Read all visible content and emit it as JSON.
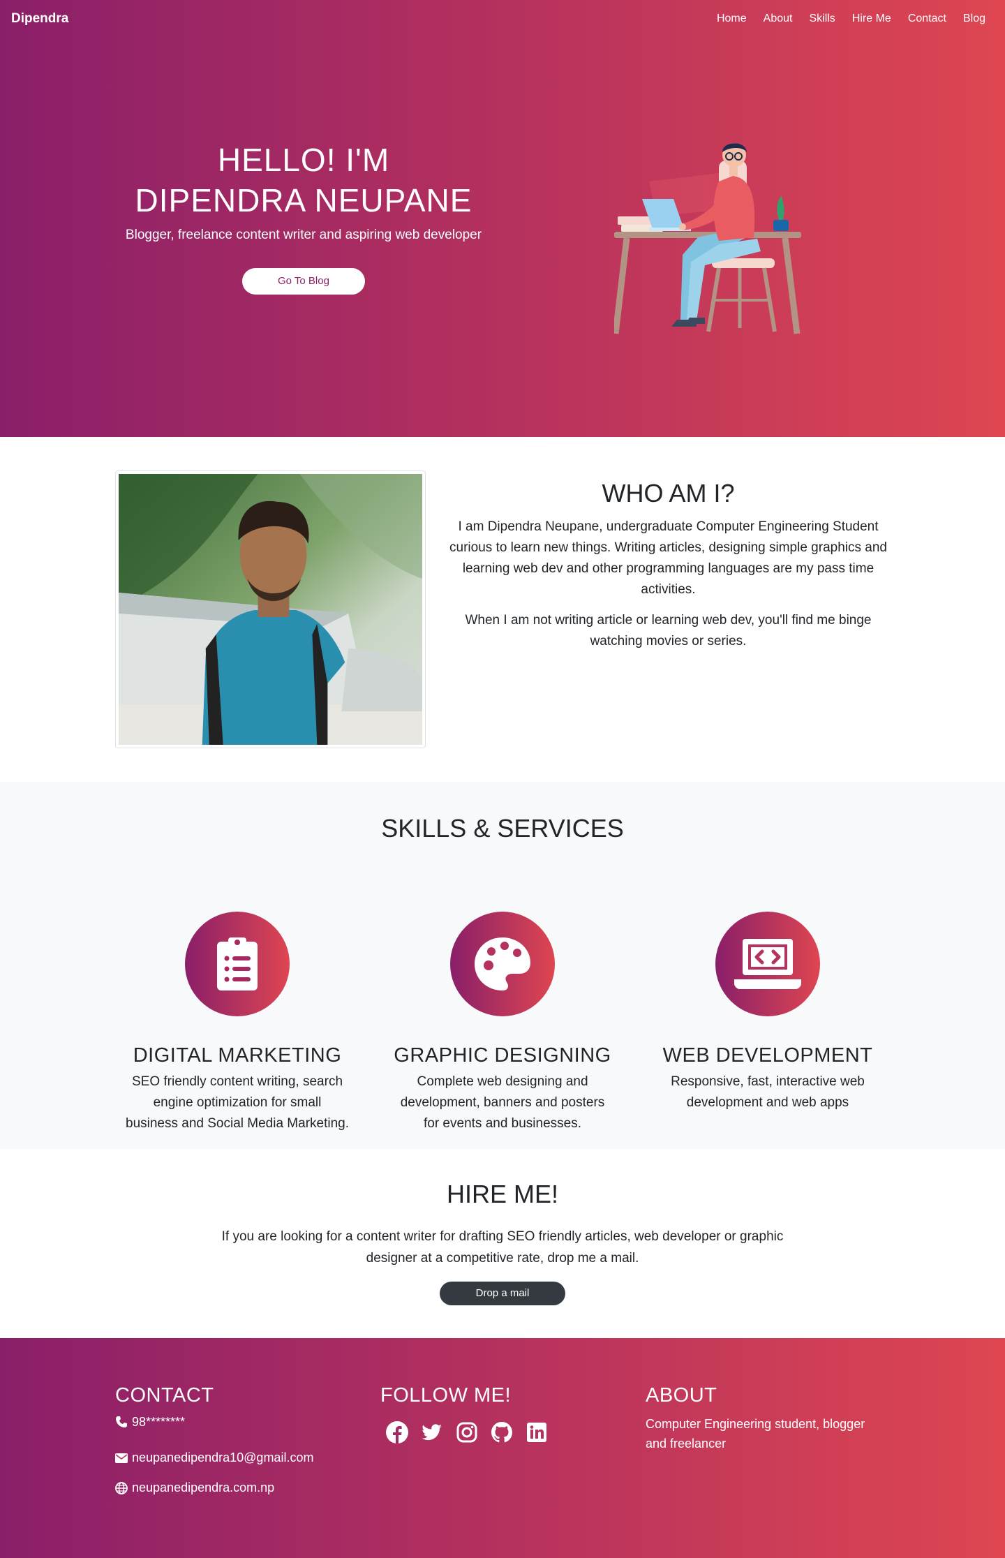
{
  "nav": {
    "brand": "Dipendra",
    "links": [
      "Home",
      "About",
      "Skills",
      "Hire Me",
      "Contact",
      "Blog"
    ]
  },
  "hero": {
    "title_line1": "HELLO! I'M",
    "title_line2": "DIPENDRA NEUPANE",
    "subtitle": "Blogger, freelance content writer and aspiring web developer",
    "button": "Go To Blog"
  },
  "about": {
    "title": "WHO AM I?",
    "para1": "I am Dipendra Neupane, undergraduate Computer Engineering Student curious to learn new things. Writing articles, designing simple graphics and learning web dev and other programming languages are my pass time activities.",
    "para2": "When I am not writing article or learning web dev, you'll find me binge watching movies or series."
  },
  "skills": {
    "title": "SKILLS & SERVICES",
    "items": [
      {
        "icon": "clipboard-list-icon",
        "title": "DIGITAL MARKETING",
        "desc": "SEO friendly content writing, search engine optimization for small business and Social Media Marketing."
      },
      {
        "icon": "palette-icon",
        "title": "GRAPHIC DESIGNING",
        "desc": "Complete web designing and development, banners and posters for events and businesses."
      },
      {
        "icon": "laptop-code-icon",
        "title": "WEB DEVELOPMENT",
        "desc": "Responsive, fast, interactive web development and web apps"
      }
    ]
  },
  "hire": {
    "title": "HIRE ME!",
    "text": "If you are looking for a content writer for drafting SEO friendly articles, web developer or graphic designer at a competitive rate, drop me a mail.",
    "button": "Drop a mail"
  },
  "footer": {
    "contact_title": "CONTACT",
    "phone": "98********",
    "email": "neupanedipendra10@gmail.com",
    "website": "neupanedipendra.com.np",
    "follow_title": "FOLLOW ME!",
    "socials": [
      "facebook-icon",
      "twitter-icon",
      "instagram-icon",
      "github-icon",
      "linkedin-icon"
    ],
    "about_title": "ABOUT",
    "about_text": "Computer Engineering student, blogger and freelancer"
  },
  "colors": {
    "gradient_start": "#8a1f69",
    "gradient_end": "#de4651",
    "dark_button": "#343a40",
    "light_section": "#f8f9fa"
  }
}
